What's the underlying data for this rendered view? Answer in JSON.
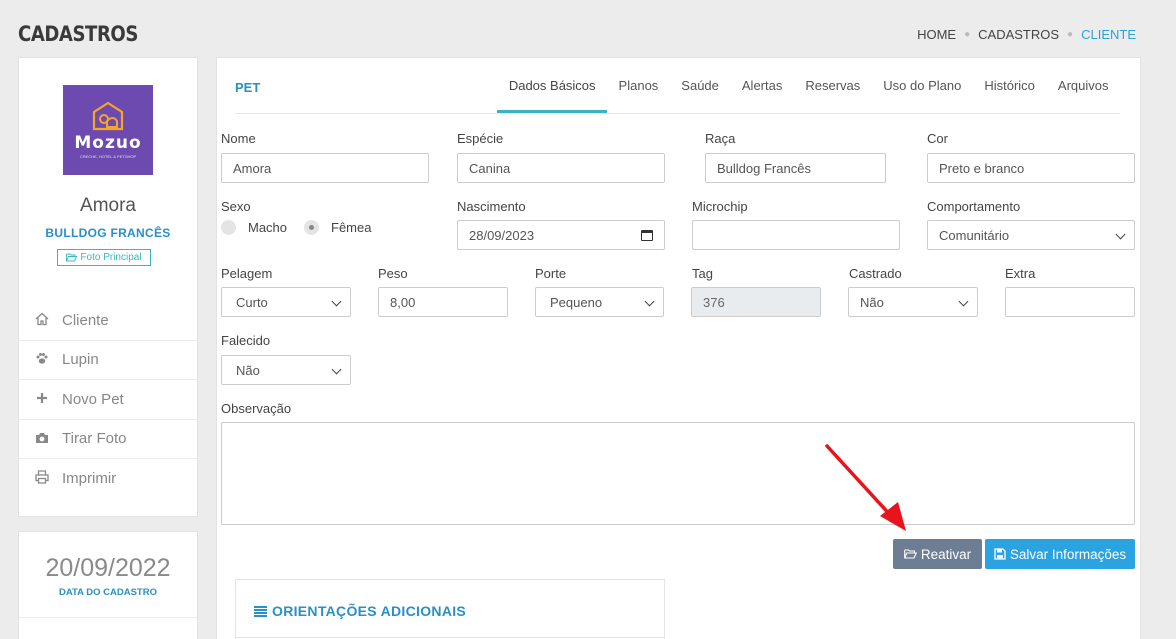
{
  "header": {
    "title": "CADASTROS",
    "breadcrumb": [
      "HOME",
      "CADASTROS",
      "CLIENTE"
    ]
  },
  "pet_profile": {
    "logo_text": "Mozuo",
    "logo_tagline": "CRECHE, HOTEL & PETSHOP",
    "name": "Amora",
    "breed": "BULLDOG FRANCÊS",
    "photo_button": "Foto Principal"
  },
  "side_menu": [
    {
      "icon": "home-icon",
      "label": "Cliente"
    },
    {
      "icon": "paw-icon",
      "label": "Lupin"
    },
    {
      "icon": "plus-icon",
      "label": "Novo Pet"
    },
    {
      "icon": "camera-icon",
      "label": "Tirar Foto"
    },
    {
      "icon": "printer-icon",
      "label": "Imprimir"
    }
  ],
  "registration": {
    "date": "20/09/2022",
    "label": "DATA DO CADASTRO"
  },
  "card": {
    "label": "PET",
    "tabs": [
      "Dados Básicos",
      "Planos",
      "Saúde",
      "Alertas",
      "Reservas",
      "Uso do Plano",
      "Histórico",
      "Arquivos"
    ],
    "active_tab": "Dados Básicos"
  },
  "form": {
    "nome": {
      "label": "Nome",
      "value": "Amora"
    },
    "especie": {
      "label": "Espécie",
      "value": "Canina"
    },
    "raca": {
      "label": "Raça",
      "value": "Bulldog Francês"
    },
    "cor": {
      "label": "Cor",
      "value": "Preto e branco"
    },
    "sexo": {
      "label": "Sexo",
      "options": [
        "Macho",
        "Fêmea"
      ],
      "selected": "Fêmea"
    },
    "nascimento": {
      "label": "Nascimento",
      "value": "28/09/2023"
    },
    "microchip": {
      "label": "Microchip",
      "value": ""
    },
    "comportamento": {
      "label": "Comportamento",
      "value": "Comunitário"
    },
    "pelagem": {
      "label": "Pelagem",
      "value": "Curto"
    },
    "peso": {
      "label": "Peso",
      "value": "8,00"
    },
    "porte": {
      "label": "Porte",
      "value": "Pequeno"
    },
    "tag": {
      "label": "Tag",
      "value": "376"
    },
    "castrado": {
      "label": "Castrado",
      "value": "Não"
    },
    "extra": {
      "label": "Extra",
      "value": ""
    },
    "falecido": {
      "label": "Falecido",
      "value": "Não"
    },
    "observacao": {
      "label": "Observação",
      "value": ""
    }
  },
  "actions": {
    "reativar": "Reativar",
    "salvar": "Salvar Informações"
  },
  "orientacoes": {
    "title": "ORIENTAÇÕES ADICIONAIS"
  },
  "colors": {
    "primary": "#2aa3e0",
    "secondary": "#6d7d94",
    "accent": "#2a8fc7",
    "logo_bg": "#6c4ab0",
    "arrow": "#e8141b"
  }
}
